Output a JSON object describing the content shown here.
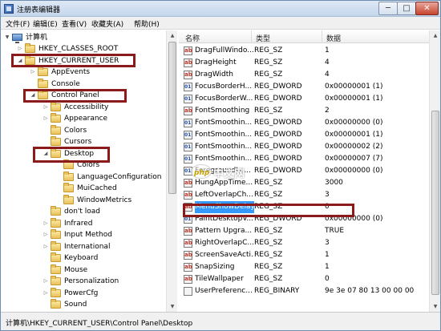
{
  "window": {
    "title": "注册表编辑器",
    "controls": {
      "minimize": "─",
      "maximize": "□",
      "close": "✕"
    }
  },
  "menu": [
    "文件(F)",
    "编辑(E)",
    "查看(V)",
    "收藏夹(A)",
    "帮助(H)"
  ],
  "tree": {
    "items": [
      {
        "label": "计算机",
        "icon": "computer-icon",
        "arrow": "▼"
      },
      {
        "label": "HKEY_CLASSES_ROOT",
        "icon": "folder-icon",
        "arrow": "▷"
      },
      {
        "label": "HKEY_CURRENT_USER",
        "icon": "folder-icon",
        "arrow": "◢"
      },
      {
        "label": "AppEvents",
        "icon": "folder-icon",
        "arrow": "▷"
      },
      {
        "label": "Console",
        "icon": "folder-icon",
        "arrow": ""
      },
      {
        "label": "Control Panel",
        "icon": "folder-icon",
        "arrow": "◢"
      },
      {
        "label": "Accessibility",
        "icon": "folder-icon",
        "arrow": "▷"
      },
      {
        "label": "Appearance",
        "icon": "folder-icon",
        "arrow": "▷"
      },
      {
        "label": "Colors",
        "icon": "folder-icon",
        "arrow": ""
      },
      {
        "label": "Cursors",
        "icon": "folder-icon",
        "arrow": ""
      },
      {
        "label": "Desktop",
        "icon": "folder-icon",
        "arrow": "◢"
      },
      {
        "label": "Colors",
        "icon": "folder-icon",
        "arrow": ""
      },
      {
        "label": "LanguageConfiguration",
        "icon": "folder-icon",
        "arrow": ""
      },
      {
        "label": "MuiCached",
        "icon": "folder-icon",
        "arrow": ""
      },
      {
        "label": "WindowMetrics",
        "icon": "folder-icon",
        "arrow": ""
      },
      {
        "label": "don't load",
        "icon": "folder-icon",
        "arrow": ""
      },
      {
        "label": "Infrared",
        "icon": "folder-icon",
        "arrow": "▷"
      },
      {
        "label": "Input Method",
        "icon": "folder-icon",
        "arrow": "▷"
      },
      {
        "label": "International",
        "icon": "folder-icon",
        "arrow": "▷"
      },
      {
        "label": "Keyboard",
        "icon": "folder-icon",
        "arrow": ""
      },
      {
        "label": "Mouse",
        "icon": "folder-icon",
        "arrow": ""
      },
      {
        "label": "Personalization",
        "icon": "folder-icon",
        "arrow": "▷"
      },
      {
        "label": "PowerCfg",
        "icon": "folder-icon",
        "arrow": "▷"
      },
      {
        "label": "Sound",
        "icon": "folder-icon",
        "arrow": ""
      }
    ]
  },
  "values": {
    "headers": {
      "name": "名称",
      "type": "类型",
      "data": "数据"
    },
    "rows": [
      {
        "icon": "sz",
        "name": "DragFullWindo...",
        "type": "REG_SZ",
        "data": "1"
      },
      {
        "icon": "sz",
        "name": "DragHeight",
        "type": "REG_SZ",
        "data": "4"
      },
      {
        "icon": "sz",
        "name": "DragWidth",
        "type": "REG_SZ",
        "data": "4"
      },
      {
        "icon": "dw",
        "name": "FocusBorderH...",
        "type": "REG_DWORD",
        "data": "0x00000001 (1)"
      },
      {
        "icon": "dw",
        "name": "FocusBorderW...",
        "type": "REG_DWORD",
        "data": "0x00000001 (1)"
      },
      {
        "icon": "sz",
        "name": "FontSmoothing",
        "type": "REG_SZ",
        "data": "2"
      },
      {
        "icon": "dw",
        "name": "FontSmoothin...",
        "type": "REG_DWORD",
        "data": "0x00000000 (0)"
      },
      {
        "icon": "dw",
        "name": "FontSmoothin...",
        "type": "REG_DWORD",
        "data": "0x00000001 (1)"
      },
      {
        "icon": "dw",
        "name": "FontSmoothin...",
        "type": "REG_DWORD",
        "data": "0x00000002 (2)"
      },
      {
        "icon": "dw",
        "name": "FontSmoothin...",
        "type": "REG_DWORD",
        "data": "0x00000007 (7)"
      },
      {
        "icon": "dw",
        "name": "ForegroundLo...",
        "type": "REG_DWORD",
        "data": "0x00000000 (0)"
      },
      {
        "icon": "sz",
        "name": "HungAppTime...",
        "type": "REG_SZ",
        "data": "3000"
      },
      {
        "icon": "sz",
        "name": "LeftOverlapCh...",
        "type": "REG_SZ",
        "data": "3"
      },
      {
        "icon": "sz",
        "name": "MenuShowDelay",
        "type": "REG_SZ",
        "data": "0",
        "selected": true
      },
      {
        "icon": "dw",
        "name": "PaintDesktopV...",
        "type": "REG_DWORD",
        "data": "0x00000000 (0)"
      },
      {
        "icon": "sz",
        "name": "Pattern Upgra...",
        "type": "REG_SZ",
        "data": "TRUE"
      },
      {
        "icon": "sz",
        "name": "RightOverlapC...",
        "type": "REG_SZ",
        "data": "3"
      },
      {
        "icon": "sz",
        "name": "ScreenSaveActi...",
        "type": "REG_SZ",
        "data": "1"
      },
      {
        "icon": "sz",
        "name": "SnapSizing",
        "type": "REG_SZ",
        "data": "1"
      },
      {
        "icon": "sz",
        "name": "TileWallpaper",
        "type": "REG_SZ",
        "data": "0"
      },
      {
        "icon": "bin",
        "name": "UserPreferenc...",
        "type": "REG_BINARY",
        "data": "9e 3e 07 80 13 00 00 00"
      }
    ]
  },
  "statusbar": {
    "path": "计算机\\HKEY_CURRENT_USER\\Control Panel\\Desktop"
  },
  "watermark": {
    "logo_text": "php",
    "text": "中文网"
  },
  "colors": {
    "highlight_box": "#8b1a1a",
    "selection": "#3399ff"
  }
}
